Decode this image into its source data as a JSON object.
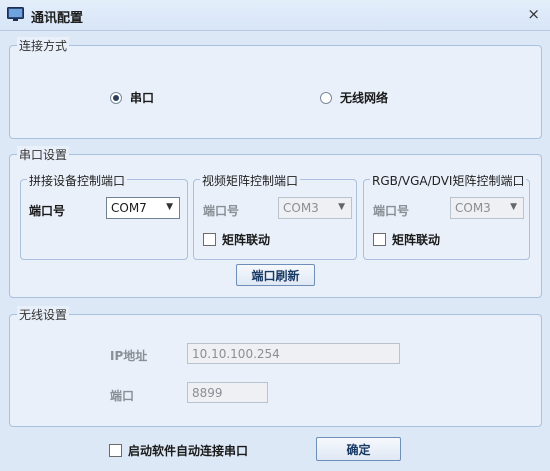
{
  "window": {
    "title": "通讯配置",
    "close": "×"
  },
  "connection": {
    "title": "连接方式",
    "serial_label": "串口",
    "serial_selected": true,
    "wireless_label": "无线网络",
    "wireless_selected": false
  },
  "serial": {
    "title": "串口设置",
    "splice": {
      "title": "拼接设备控制端口",
      "port_label": "端口号",
      "port_value": "COM7"
    },
    "video": {
      "title": "视频矩阵控制端口",
      "port_label": "端口号",
      "port_value": "COM3",
      "link_label": "矩阵联动"
    },
    "rgb": {
      "title": "RGB/VGA/DVI矩阵控制端口",
      "port_label": "端口号",
      "port_value": "COM3",
      "link_label": "矩阵联动"
    },
    "refresh_label": "端口刷新"
  },
  "wireless": {
    "title": "无线设置",
    "ip_label": "IP地址",
    "ip_value": "10.10.100.254",
    "port_label": "端口",
    "port_value": "8899"
  },
  "footer": {
    "autoconnect_label": "启动软件自动连接串口",
    "ok_label": "确定"
  }
}
